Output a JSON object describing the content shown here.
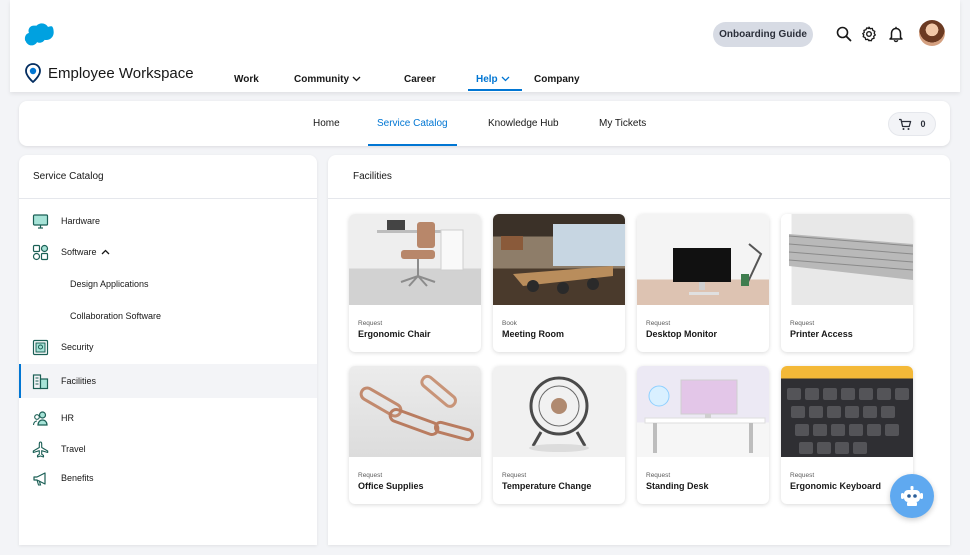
{
  "header": {
    "onboarding_label": "Onboarding Guide",
    "brand_name": "Employee Workspace",
    "brand_color": "#0176d3",
    "icons": [
      "search-icon",
      "gear-icon",
      "bell-icon"
    ],
    "nav": [
      {
        "label": "Work",
        "dropdown": false,
        "active": false
      },
      {
        "label": "Community",
        "dropdown": true,
        "active": false
      },
      {
        "label": "Career",
        "dropdown": false,
        "active": false
      },
      {
        "label": "Help",
        "dropdown": true,
        "active": true
      },
      {
        "label": "Company",
        "dropdown": false,
        "active": false
      }
    ]
  },
  "subnav": {
    "items": [
      {
        "label": "Home",
        "active": false
      },
      {
        "label": "Service Catalog",
        "active": true
      },
      {
        "label": "Knowledge Hub",
        "active": false
      },
      {
        "label": "My Tickets",
        "active": false
      }
    ],
    "cart_count": "0"
  },
  "sidebar": {
    "title": "Service Catalog",
    "items": [
      {
        "label": "Hardware",
        "icon": "monitor-icon"
      },
      {
        "label": "Software",
        "icon": "apps-icon",
        "expanded": true
      },
      {
        "label": "Design Applications",
        "sub": true
      },
      {
        "label": "Collaboration Software",
        "sub": true
      },
      {
        "label": "Security",
        "icon": "security-icon"
      },
      {
        "label": "Facilities",
        "icon": "building-icon",
        "active": true
      },
      {
        "label": "HR",
        "icon": "people-icon"
      },
      {
        "label": "Travel",
        "icon": "airplane-icon"
      },
      {
        "label": "Benefits",
        "icon": "megaphone-icon"
      }
    ]
  },
  "main": {
    "title": "Facilities",
    "cards": [
      {
        "kicker": "Request",
        "name": "Ergonomic Chair"
      },
      {
        "kicker": "Book",
        "name": "Meeting Room"
      },
      {
        "kicker": "Request",
        "name": "Desktop Monitor"
      },
      {
        "kicker": "Request",
        "name": "Printer Access"
      },
      {
        "kicker": "Request",
        "name": "Office Supplies"
      },
      {
        "kicker": "Request",
        "name": "Temperature Change"
      },
      {
        "kicker": "Request",
        "name": "Standing Desk"
      },
      {
        "kicker": "Request",
        "name": "Ergonomic Keyboard"
      }
    ]
  }
}
